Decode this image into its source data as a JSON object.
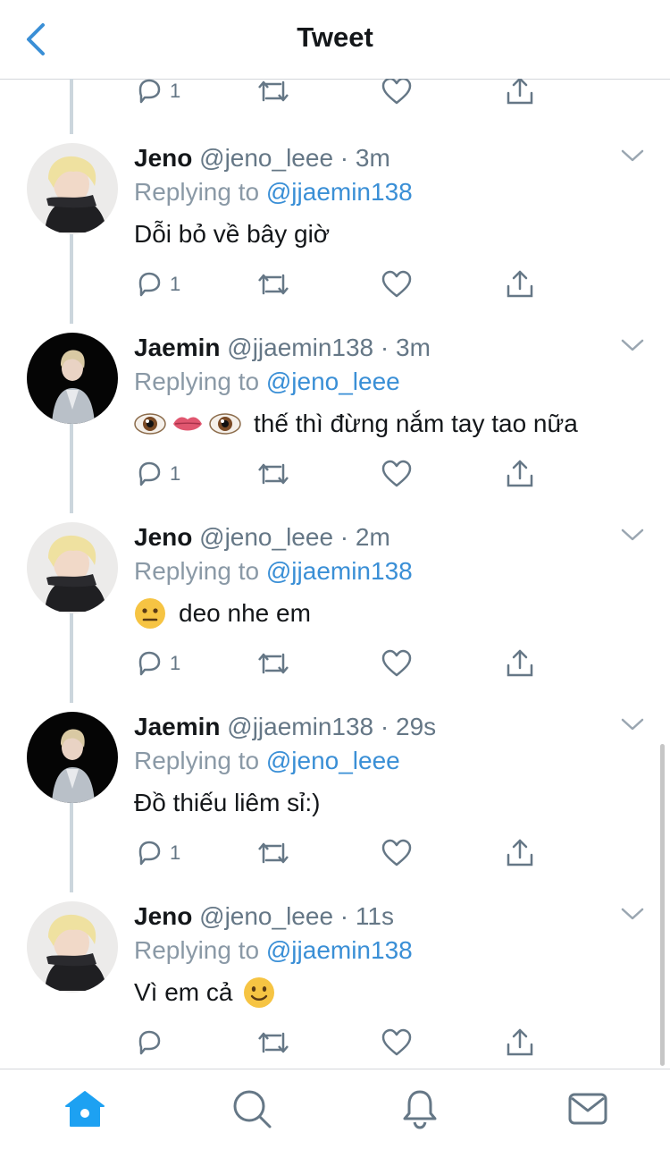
{
  "header": {
    "title": "Tweet"
  },
  "top_actions": {
    "reply_count": "1"
  },
  "tweets": [
    {
      "name": "Jeno",
      "handle": "@jeno_leee",
      "time": "3m",
      "replying_label": "Replying to",
      "replying_to": "@jjaemin138",
      "text": "Dỗi bỏ về bây giờ",
      "emoji": [],
      "reply_count": "1"
    },
    {
      "name": "Jaemin",
      "handle": "@jjaemin138",
      "time": "3m",
      "replying_label": "Replying to",
      "replying_to": "@jeno_leee",
      "text": "thế thì đừng nắm tay tao nữa",
      "emoji": [
        "eye",
        "lips",
        "eye"
      ],
      "reply_count": "1"
    },
    {
      "name": "Jeno",
      "handle": "@jeno_leee",
      "time": "2m",
      "replying_label": "Replying to",
      "replying_to": "@jjaemin138",
      "text": "deo nhe em",
      "emoji": [
        "neutral-face"
      ],
      "reply_count": "1"
    },
    {
      "name": "Jaemin",
      "handle": "@jjaemin138",
      "time": "29s",
      "replying_label": "Replying to",
      "replying_to": "@jeno_leee",
      "text": "Đồ thiếu liêm sỉ:)",
      "emoji": [],
      "reply_count": "1"
    },
    {
      "name": "Jeno",
      "handle": "@jeno_leee",
      "time": "11s",
      "replying_label": "Replying to",
      "replying_to": "@jjaemin138",
      "text": "Vì em cả",
      "emoji_after": [
        "slight-smile"
      ],
      "reply_count": ""
    }
  ],
  "tabbar": [
    "home-icon",
    "search-icon",
    "notifications-icon",
    "messages-icon"
  ],
  "colors": {
    "accent": "#1da1f2",
    "muted": "#657786",
    "link": "#3a8fd6"
  }
}
